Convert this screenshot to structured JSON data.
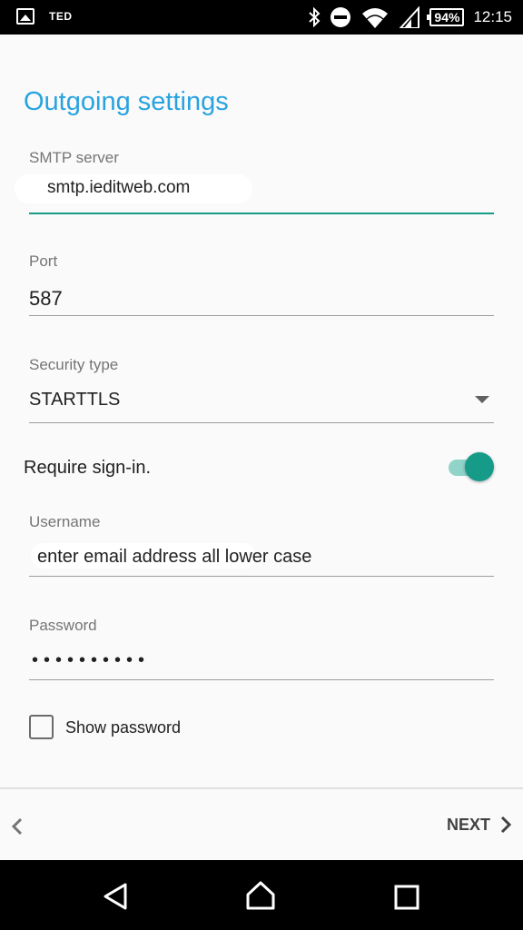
{
  "status_bar": {
    "carrier": "TED",
    "battery": "94%",
    "time": "12:15",
    "icons": [
      "image-icon",
      "bluetooth-icon",
      "do-not-disturb-icon",
      "wifi-icon",
      "signal-icon",
      "battery-icon"
    ]
  },
  "page": {
    "title": "Outgoing settings"
  },
  "smtp": {
    "label": "SMTP server",
    "value": "smtp.ieditweb.com"
  },
  "port": {
    "label": "Port",
    "value": "587"
  },
  "security": {
    "label": "Security type",
    "value": "STARTTLS"
  },
  "signin": {
    "label": "Require sign-in.",
    "enabled": true
  },
  "username": {
    "label": "Username",
    "value": "enter email address all lower case"
  },
  "password": {
    "label": "Password",
    "value": "••••••••••"
  },
  "show_password": {
    "label": "Show password",
    "checked": false
  },
  "footer": {
    "next_label": "NEXT"
  },
  "colors": {
    "accent": "#169b89",
    "title": "#29a3e0"
  }
}
